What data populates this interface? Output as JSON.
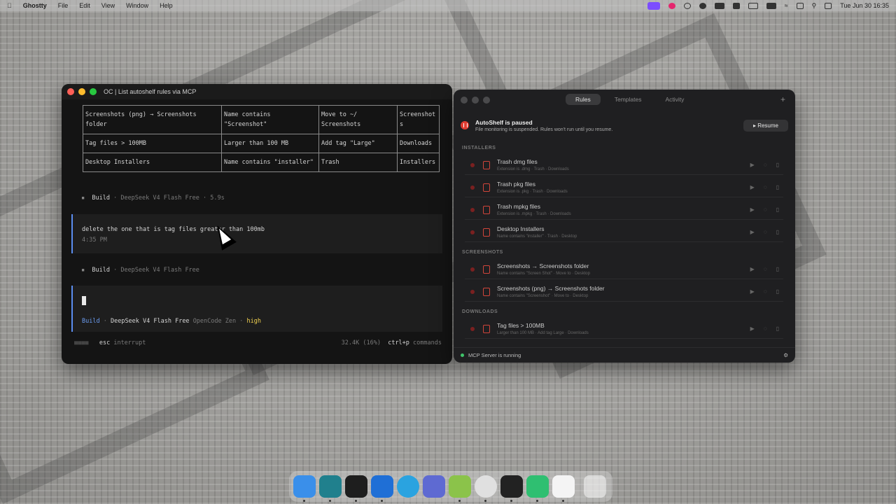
{
  "menubar": {
    "app": "Ghostty",
    "menus": [
      "File",
      "Edit",
      "View",
      "Window",
      "Help"
    ],
    "clock": "Tue Jun 30  16:35"
  },
  "terminal": {
    "title": "OC | List autoshelf rules via MCP",
    "table_rows": [
      [
        "Screenshots (png) → Screenshots folder",
        "Name contains \"Screenshot\"",
        "Move to ~/ Screenshots",
        "Screenshot s"
      ],
      [
        "Tag files > 100MB",
        "Larger than 100 MB",
        "Add tag \"Large\"",
        "Downloads"
      ],
      [
        "Desktop Installers",
        "Name contains \"installer\"",
        "Trash",
        "Installers"
      ]
    ],
    "build1": {
      "bullet": "▪",
      "label": "Build",
      "meta": "· DeepSeek V4 Flash Free · 5.9s"
    },
    "message": {
      "text": "delete the one that is tag files greater than 100mb",
      "time": "4:35 PM"
    },
    "build2": {
      "bullet": "▪",
      "label": "Build",
      "meta": "· DeepSeek V4 Flash Free"
    },
    "status": {
      "mode": "Build",
      "sep": "·",
      "model": "DeepSeek V4 Flash Free",
      "provider": "OpenCode Zen",
      "sep2": "·",
      "effort": "high"
    },
    "footer": {
      "key": "esc",
      "action": "interrupt",
      "tokens": "32.4K (16%)",
      "cmd_key": "ctrl+p",
      "cmd_label": "commands"
    }
  },
  "autoshelf": {
    "tabs": [
      "Rules",
      "Templates",
      "Activity"
    ],
    "add": "+",
    "paused_title": "AutoShelf is paused",
    "paused_sub": "File monitoring is suspended. Rules won't run until you resume.",
    "resume": "▸ Resume",
    "sections": [
      {
        "name": "INSTALLERS",
        "rules": [
          {
            "title": "Trash dmg files",
            "sub": "Extension is .dmg · Trash · Downloads"
          },
          {
            "title": "Trash pkg files",
            "sub": "Extension is .pkg · Trash · Downloads"
          },
          {
            "title": "Trash mpkg files",
            "sub": "Extension is .mpkg · Trash · Downloads"
          },
          {
            "title": "Desktop Installers",
            "sub": "Name contains \"installer\" · Trash · Desktop"
          }
        ]
      },
      {
        "name": "SCREENSHOTS",
        "rules": [
          {
            "title": "Screenshots → Screenshots folder",
            "sub": "Name contains \"Screen Shot\" · Move to · Desktop"
          },
          {
            "title": "Screenshots (png) → Screenshots folder",
            "sub": "Name contains \"Screenshot\" · Move to · Desktop"
          }
        ]
      },
      {
        "name": "DOWNLOADS",
        "rules": [
          {
            "title": "Tag files > 100MB",
            "sub": "Larger than 100 MB · Add tag Large · Downloads"
          }
        ]
      }
    ],
    "footer": "MCP Server is running"
  },
  "dock": [
    "finder-icon",
    "perplexity-icon",
    "figma-icon",
    "xcode-icon",
    "telegram-icon",
    "linear-icon",
    "notes-icon",
    "safari-icon",
    "terminal-icon",
    "chatgpt-icon",
    "pdf-icon",
    "trash-icon"
  ],
  "colors": {
    "accent": "#5b8def",
    "paused_red": "#e03c31",
    "running_green": "#3fc46a",
    "effort_yellow": "#f0d050"
  }
}
